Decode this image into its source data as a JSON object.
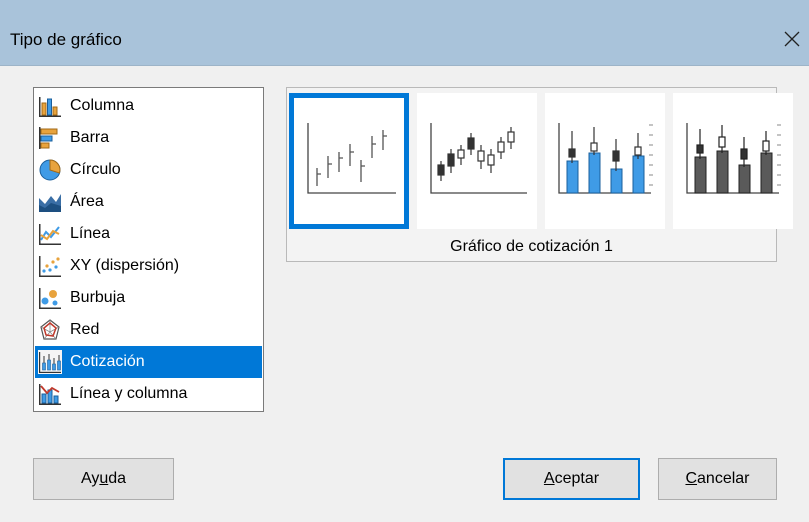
{
  "window": {
    "title": "Tipo de gráfico"
  },
  "chart_types": [
    {
      "label": "Columna",
      "icon": "column-chart-icon"
    },
    {
      "label": "Barra",
      "icon": "bar-chart-icon"
    },
    {
      "label": "Círculo",
      "icon": "pie-chart-icon"
    },
    {
      "label": "Área",
      "icon": "area-chart-icon"
    },
    {
      "label": "Línea",
      "icon": "line-chart-icon"
    },
    {
      "label": "XY (dispersión)",
      "icon": "xy-scatter-chart-icon"
    },
    {
      "label": "Burbuja",
      "icon": "bubble-chart-icon"
    },
    {
      "label": "Red",
      "icon": "net-chart-icon"
    },
    {
      "label": "Cotización",
      "icon": "stock-chart-icon"
    },
    {
      "label": "Línea y columna",
      "icon": "line-and-column-chart-icon"
    }
  ],
  "selected_chart_type": "Cotización",
  "variants": {
    "caption": "Gráfico de cotización 1",
    "selected_index": 0,
    "icons": [
      "stock-1-icon",
      "stock-2-icon",
      "stock-3-icon",
      "stock-4-icon"
    ]
  },
  "buttons": {
    "help": {
      "label_pre": "Ay",
      "label_u": "u",
      "label_post": "da"
    },
    "ok": {
      "label_pre": "",
      "label_u": "A",
      "label_post": "ceptar"
    },
    "cancel": {
      "label_pre": "",
      "label_u": "C",
      "label_post": "ancelar"
    }
  },
  "colors": {
    "selection": "#0078d7",
    "titlebar": "#a9c3da",
    "bar_fill": "#3f9be6",
    "dark_bar_fill": "#555555"
  }
}
